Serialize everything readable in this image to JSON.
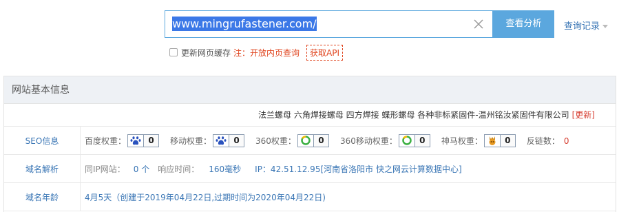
{
  "search": {
    "value": "www.mingrufastener.com/",
    "button_label": "查看分析",
    "history_label": "查询记录"
  },
  "options": {
    "cache_label": "更新网页缓存",
    "note": "注：开放内页查询",
    "api_label": "获取API"
  },
  "panel": {
    "title": "网站基本信息",
    "site_title": "法兰螺母 六角焊接螺母 四方焊接 蝶形螺母 各种非标紧固件-温州铭汝紧固件有限公司",
    "refresh_label": "[更新]",
    "seo": {
      "label": "SEO信息",
      "weights": [
        {
          "label": "百度权重：",
          "value": "0",
          "icon": "baidu-paw-icon"
        },
        {
          "label": "移动权重：",
          "value": "0",
          "icon": "baidu-paw-icon"
        },
        {
          "label": "360权重：",
          "value": "0",
          "icon": "360-icon"
        },
        {
          "label": "360移动权重：",
          "value": "0",
          "icon": "360-icon"
        },
        {
          "label": "神马权重：",
          "value": "0",
          "icon": "shenma-icon"
        }
      ],
      "outlinks_label": "反链数：",
      "outlinks_value": "0"
    },
    "dns": {
      "label": "域名解析",
      "same_ip_label": "同IP网站：",
      "same_ip_value": "0 个",
      "response_label": "响应时间：",
      "response_value": "160毫秒",
      "ip_text": "IP：42.51.12.95[河南省洛阳市 快之网云计算数据中心]"
    },
    "age": {
      "label": "域名年龄",
      "value": "4月5天（创建于2019年04月22日,过期时间为2020年04月22日)"
    }
  },
  "colors": {
    "accent": "#5ba7de",
    "link": "#3a76b5",
    "warning": "#e0451f"
  }
}
